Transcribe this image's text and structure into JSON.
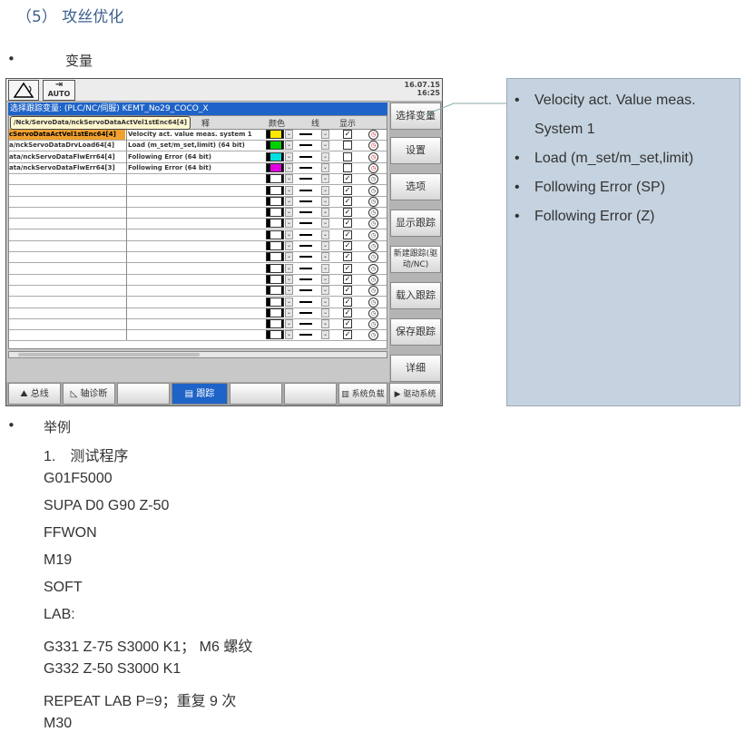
{
  "heading": "（5） 攻丝优化",
  "bullet_variables": "变量",
  "hmi": {
    "mode_label": "AUTO",
    "date": "16.07.15",
    "time": "16:25",
    "title": "选择跟踪变量: (PLC/NC/伺服) KEMT_No29_COCO_X",
    "tooltip": "/Nck/ServoData/nckServoDataActVel1stEnc64[4]",
    "columns": [
      "释",
      "颜色",
      "线",
      "显示"
    ],
    "rows": [
      {
        "var": "cServoDataActVel1stEnc64[4]",
        "desc": "Velocity act. value meas. system 1",
        "color": "#ffe800",
        "checked": true,
        "hl": true
      },
      {
        "var": "a/nckServoDataDrvLoad64[4]",
        "desc": "Load (m_set/m_set,limit) (64 bit)",
        "color": "#00d000",
        "checked": false,
        "hl": false
      },
      {
        "var": "ata/nckServoDataFlwErr64[4]",
        "desc": "Following Error (64 bit)",
        "color": "#00e0e0",
        "checked": false,
        "hl": false
      },
      {
        "var": "ata/nckServoDataFlwErr64[3]",
        "desc": "Following Error (64 bit)",
        "color": "#e000e0",
        "checked": false,
        "hl": false
      }
    ],
    "softkeys": [
      "选择变量",
      "设置",
      "选项",
      "显示跟踪",
      "新建跟踪(驱动/NC)",
      "载入跟踪",
      "保存跟踪",
      "详细"
    ],
    "hkeys": [
      "总线",
      "轴诊断",
      "",
      "跟踪",
      "",
      "",
      "系统负载",
      "驱动系统"
    ]
  },
  "info_items": [
    "Velocity act. Value meas.",
    "System 1",
    "Load (m_set/m_set,limit)",
    "Following Error (SP)",
    "Following Error (Z)"
  ],
  "bullet_example": "举例",
  "code_title": "1.　测试程序",
  "code_lines": [
    "G01F5000",
    "SUPA D0 G90 Z-50",
    "FFWON",
    "M19",
    "SOFT",
    "LAB:",
    "G331 Z-75 S3000 K1；  M6 螺纹",
    "G332 Z-50 S3000 K1",
    "REPEAT LAB P=9；重复 9 次",
    "M30"
  ]
}
